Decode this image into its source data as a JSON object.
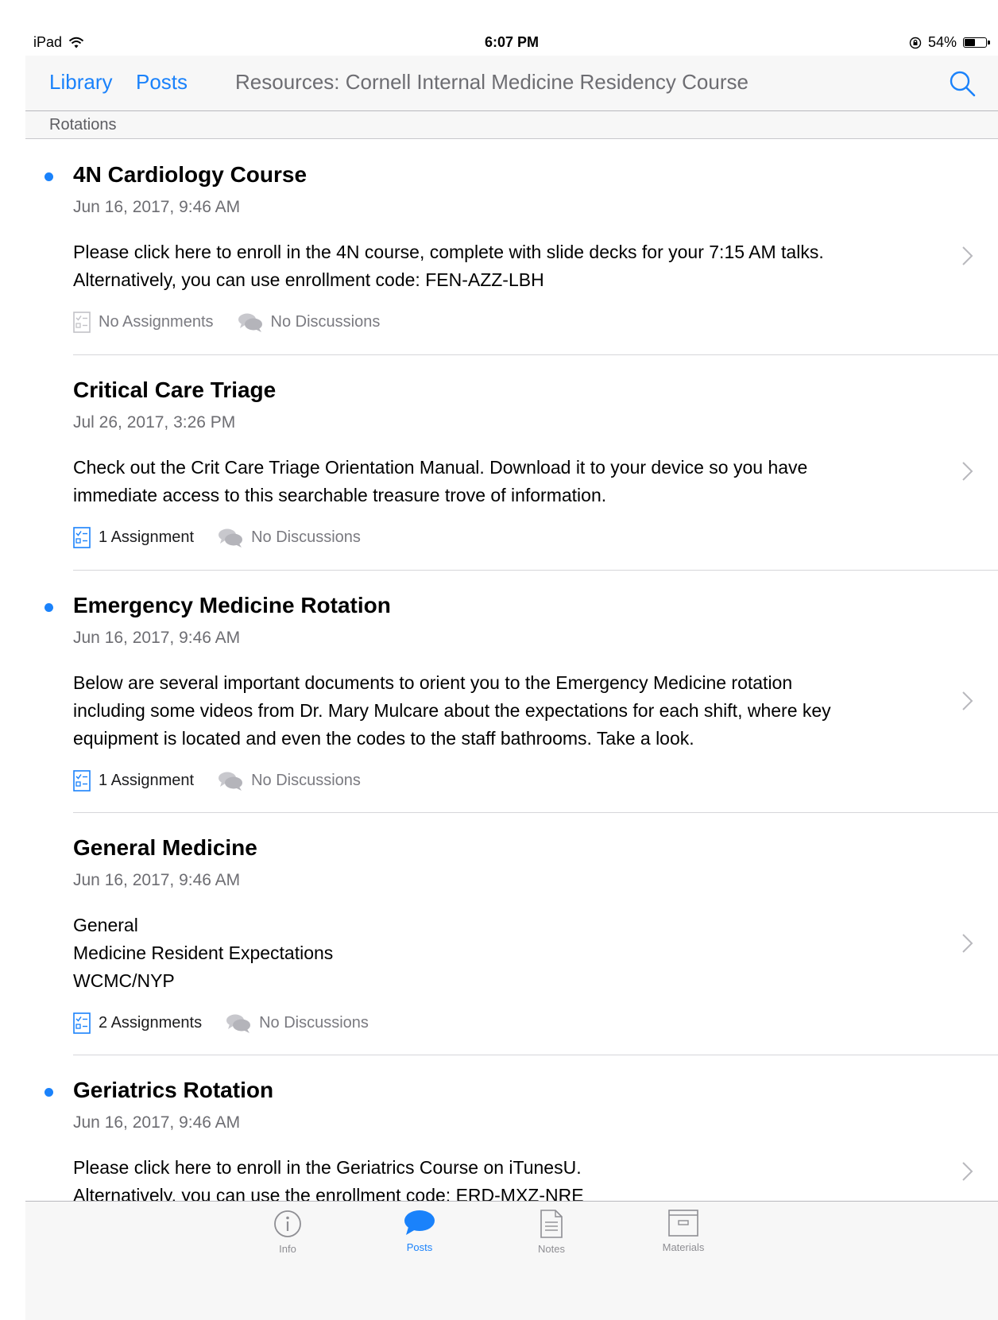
{
  "status_bar": {
    "device": "iPad",
    "time": "6:07 PM",
    "battery": "54%",
    "battery_level": 0.54
  },
  "nav": {
    "library_label": "Library",
    "posts_label": "Posts",
    "title": "Resources: Cornell Internal Medicine Residency Course",
    "section": "Rotations",
    "search_icon": "search-icon"
  },
  "posts": [
    {
      "unread": true,
      "title": "4N Cardiology Course",
      "date": "Jun 16, 2017, 9:46 AM",
      "body": "Please click here to enroll in the 4N course, complete with slide decks for your 7:15 AM talks.\nAlternatively, you can use enrollment code: FEN-AZZ-LBH",
      "assignments": "No Assignments",
      "assignments_active": false,
      "discussions": "No Discussions"
    },
    {
      "unread": false,
      "title": "Critical Care Triage",
      "date": "Jul 26, 2017, 3:26 PM",
      "body": "Check out the Crit Care Triage Orientation Manual.  Download it to your device so you have\nimmediate access to this searchable treasure trove of information.",
      "assignments": "1 Assignment",
      "assignments_active": true,
      "discussions": "No Discussions"
    },
    {
      "unread": true,
      "title": "Emergency Medicine Rotation",
      "date": "Jun 16, 2017, 9:46 AM",
      "body": "Below are several important documents to orient you to the Emergency Medicine rotation\nincluding some videos from Dr. Mary Mulcare about the expectations for each shift, where key\nequipment is located and even the codes to the staff bathrooms.  Take a look.",
      "assignments": "1 Assignment",
      "assignments_active": true,
      "discussions": "No Discussions"
    },
    {
      "unread": false,
      "title": "General Medicine",
      "date": "Jun 16, 2017, 9:46 AM",
      "body": "General\nMedicine Resident Expectations\nWCMC/NYP",
      "assignments": "2 Assignments",
      "assignments_active": true,
      "discussions": "No Discussions"
    },
    {
      "unread": true,
      "title": "Geriatrics Rotation",
      "date": "Jun 16, 2017, 9:46 AM",
      "body": "Please click here to enroll in the Geriatrics Course on iTunesU.\nAlternatively, you can use the enrollment code: ERD-MXZ-NRE",
      "assignments": "",
      "assignments_active": false,
      "discussions": ""
    }
  ],
  "tabs": [
    {
      "label": "Info",
      "icon": "info-icon",
      "active": false
    },
    {
      "label": "Posts",
      "icon": "posts-icon",
      "active": true
    },
    {
      "label": "Notes",
      "icon": "notes-icon",
      "active": false
    },
    {
      "label": "Materials",
      "icon": "materials-icon",
      "active": false
    }
  ],
  "colors": {
    "accent": "#1a82fb",
    "secondary_text": "#6d6d72",
    "separator": "#d6d6da"
  }
}
